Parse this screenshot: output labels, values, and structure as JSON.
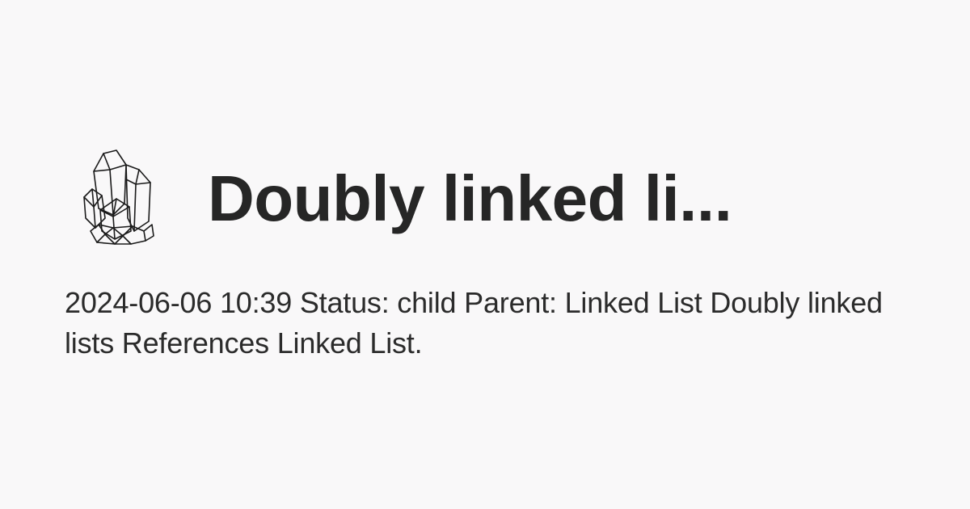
{
  "card": {
    "icon": "crystal-cluster-icon",
    "title": "Doubly linked li...",
    "description": "2024-06-06 10:39 Status: child Parent: Linked List Doubly linked lists References Linked List."
  },
  "colors": {
    "background": "#f9f8f9",
    "text": "#262626",
    "icon_stroke": "#1a1a1a"
  }
}
